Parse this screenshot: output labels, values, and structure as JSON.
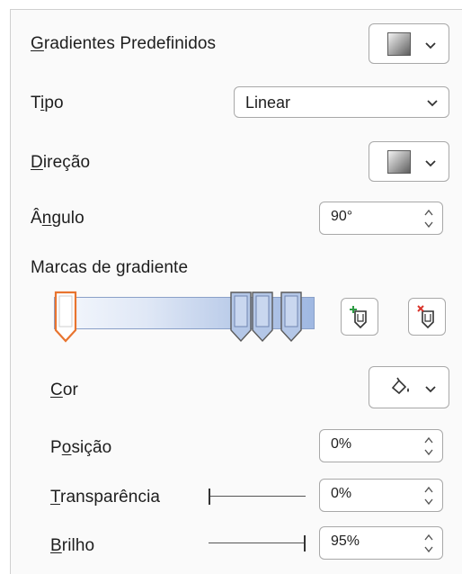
{
  "presets": {
    "label_first": "G",
    "label_rest": "radientes Predefinidos"
  },
  "type": {
    "label_first": "T",
    "label_mid": "i",
    "label_rest": "po",
    "value": "Linear"
  },
  "direction": {
    "label_first": "D",
    "label_rest": "ireção"
  },
  "angle": {
    "label_first": "Â",
    "label_mid": "n",
    "label_rest": "gulo",
    "value": "90°"
  },
  "stops": {
    "label": "Marcas de gradiente",
    "positions_percent": [
      0,
      74,
      83,
      95
    ],
    "selected_index": 0
  },
  "color": {
    "label_first": "C",
    "label_rest": "or"
  },
  "position": {
    "label_first": "P",
    "label_mid": "o",
    "label_rest": "sição",
    "value": "0%"
  },
  "transparency": {
    "label_first": "T",
    "label_rest": "ransparência",
    "value": "0%",
    "slider_fraction": 0
  },
  "brightness": {
    "label_first": "B",
    "label_rest": "rilho",
    "value": "95%",
    "slider_fraction": 1
  },
  "colors": {
    "selected_outline": "#e8742f",
    "stop_fill": "#b4c7e7",
    "add_plus": "#2e9b44",
    "remove_x": "#d9342b"
  }
}
